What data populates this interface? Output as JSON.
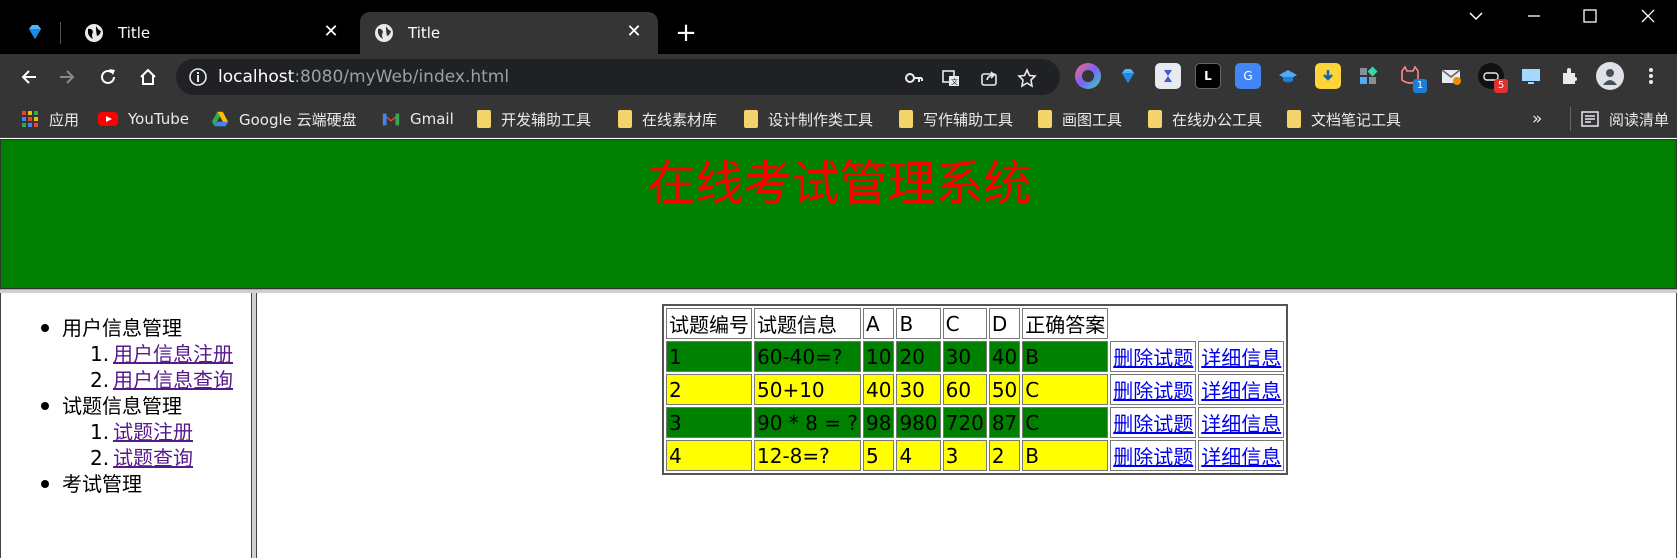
{
  "browser": {
    "tabs": [
      {
        "title": "Title"
      },
      {
        "title": "Title"
      }
    ],
    "url": {
      "host": "localhost",
      "path": ":8080/myWeb/index.html"
    },
    "bookmarks": [
      {
        "label": "应用",
        "icon": "apps-grid-icon"
      },
      {
        "label": "YouTube",
        "icon": "youtube-icon"
      },
      {
        "label": "Google 云端硬盘",
        "icon": "google-drive-icon"
      },
      {
        "label": "Gmail",
        "icon": "gmail-icon"
      },
      {
        "label": "开发辅助工具",
        "icon": "folder-icon"
      },
      {
        "label": "在线素材库",
        "icon": "folder-icon"
      },
      {
        "label": "设计制作类工具",
        "icon": "folder-icon"
      },
      {
        "label": "写作辅助工具",
        "icon": "folder-icon"
      },
      {
        "label": "画图工具",
        "icon": "folder-icon"
      },
      {
        "label": "在线办公工具",
        "icon": "folder-icon"
      },
      {
        "label": "文档笔记工具",
        "icon": "folder-icon"
      }
    ],
    "bookmarks_more": "»",
    "reading_list": "阅读清单",
    "extension_badges": {
      "cat": "1",
      "game": "5"
    }
  },
  "page": {
    "title": "在线考试管理系统",
    "menu": {
      "user_section": "用户信息管理",
      "user_register": "用户信息注册",
      "user_query": "用户信息查询",
      "question_section": "试题信息管理",
      "question_register": "试题注册",
      "question_query": "试题查询",
      "exam_section": "考试管理",
      "num1": "1.",
      "num2": "2."
    },
    "table": {
      "headers": [
        "试题编号",
        "试题信息",
        "A",
        "B",
        "C",
        "D",
        "正确答案"
      ],
      "rows": [
        {
          "id": "1",
          "info": "60-40=?",
          "a": "10",
          "b": "20",
          "c": "30",
          "d": "40",
          "answer": "B",
          "delete": "删除试题",
          "detail": "详细信息"
        },
        {
          "id": "2",
          "info": "50+10",
          "a": "40",
          "b": "30",
          "c": "60",
          "d": "50",
          "answer": "C",
          "delete": "删除试题",
          "detail": "详细信息"
        },
        {
          "id": "3",
          "info": "90 * 8 = ?",
          "a": "98",
          "b": "980",
          "c": "720",
          "d": "87",
          "answer": "C",
          "delete": "删除试题",
          "detail": "详细信息"
        },
        {
          "id": "4",
          "info": "12-8=?",
          "a": "5",
          "b": "4",
          "c": "3",
          "d": "2",
          "answer": "B",
          "delete": "删除试题",
          "detail": "详细信息"
        }
      ]
    }
  }
}
